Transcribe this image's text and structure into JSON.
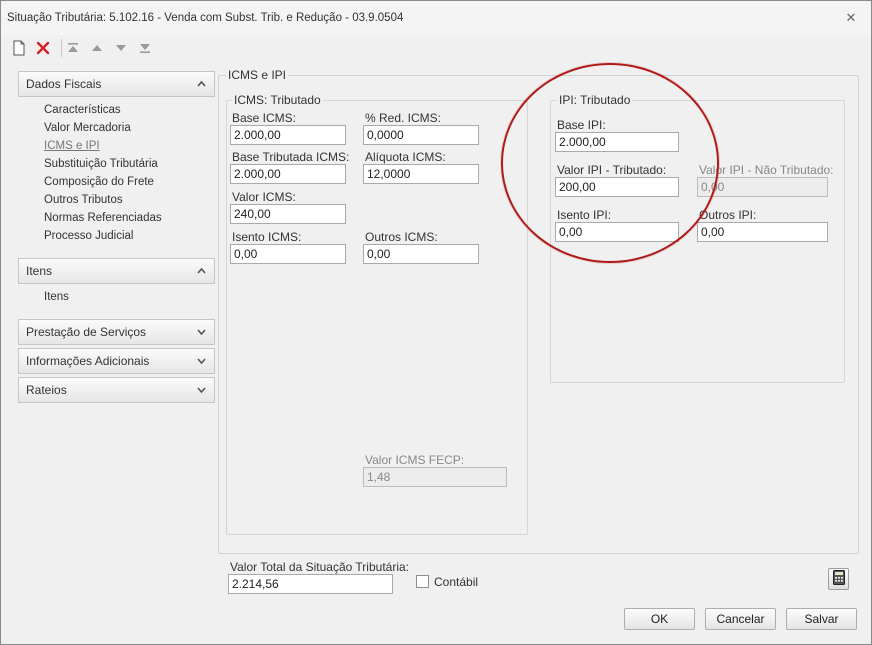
{
  "window": {
    "title": "Situação Tributária: 5.102.16 - Venda com Subst. Trib. e Redução - 03.9.0504",
    "close_glyph": "✕"
  },
  "toolbar": {
    "icons": [
      "new-document-icon",
      "delete-icon",
      "move-first-icon",
      "move-up-icon",
      "move-down-icon",
      "move-last-icon"
    ]
  },
  "nav": {
    "sections": [
      {
        "label": "Dados Fiscais",
        "expanded": true
      },
      {
        "label": "Itens",
        "expanded": true
      },
      {
        "label": "Prestação de Serviços",
        "expanded": false
      },
      {
        "label": "Informações Adicionais",
        "expanded": false
      },
      {
        "label": "Rateios",
        "expanded": false
      }
    ],
    "dados_fiscais_items": [
      "Características",
      "Valor Mercadoria",
      "ICMS e IPI",
      "Substituição Tributária",
      "Composição do Frete",
      "Outros Tributos",
      "Normas Referenciadas",
      "Processo Judicial"
    ],
    "itens_items": [
      "Itens"
    ],
    "active_item": "ICMS e IPI"
  },
  "icms_ipi": {
    "group_title": "ICMS e IPI",
    "icms": {
      "title": "ICMS: Tributado",
      "base_icms": {
        "label": "Base ICMS:",
        "value": "2.000,00"
      },
      "red_icms": {
        "label": "% Red. ICMS:",
        "value": "0,0000"
      },
      "base_tributada": {
        "label": "Base Tributada ICMS:",
        "value": "2.000,00"
      },
      "aliquota": {
        "label": "Alíquota ICMS:",
        "value": "12,0000"
      },
      "valor_icms": {
        "label": "Valor ICMS:",
        "value": "240,00"
      },
      "isento_icms": {
        "label": "Isento ICMS:",
        "value": "0,00"
      },
      "outros_icms": {
        "label": "Outros ICMS:",
        "value": "0,00"
      },
      "valor_fecp": {
        "label": "Valor ICMS FECP:",
        "value": "1,48"
      }
    },
    "ipi": {
      "title": "IPI: Tributado",
      "base_ipi": {
        "label": "Base IPI:",
        "value": "2.000,00"
      },
      "valor_tributado": {
        "label": "Valor IPI - Tributado:",
        "value": "200,00"
      },
      "valor_nao_tributado": {
        "label": "Valor IPI - Não Tributado:",
        "value": "0,00"
      },
      "isento_ipi": {
        "label": "Isento IPI:",
        "value": "0,00"
      },
      "outros_ipi": {
        "label": "Outros IPI:",
        "value": "0,00"
      }
    }
  },
  "footer": {
    "valor_total_label": "Valor Total da Situação Tributária:",
    "valor_total": "2.214,56",
    "contabil_label": "Contábil",
    "contabil_checked": false,
    "ok_label": "OK",
    "cancel_label": "Cancelar",
    "save_label": "Salvar"
  },
  "annotation": {
    "highlight_color": "#b01a1a"
  }
}
